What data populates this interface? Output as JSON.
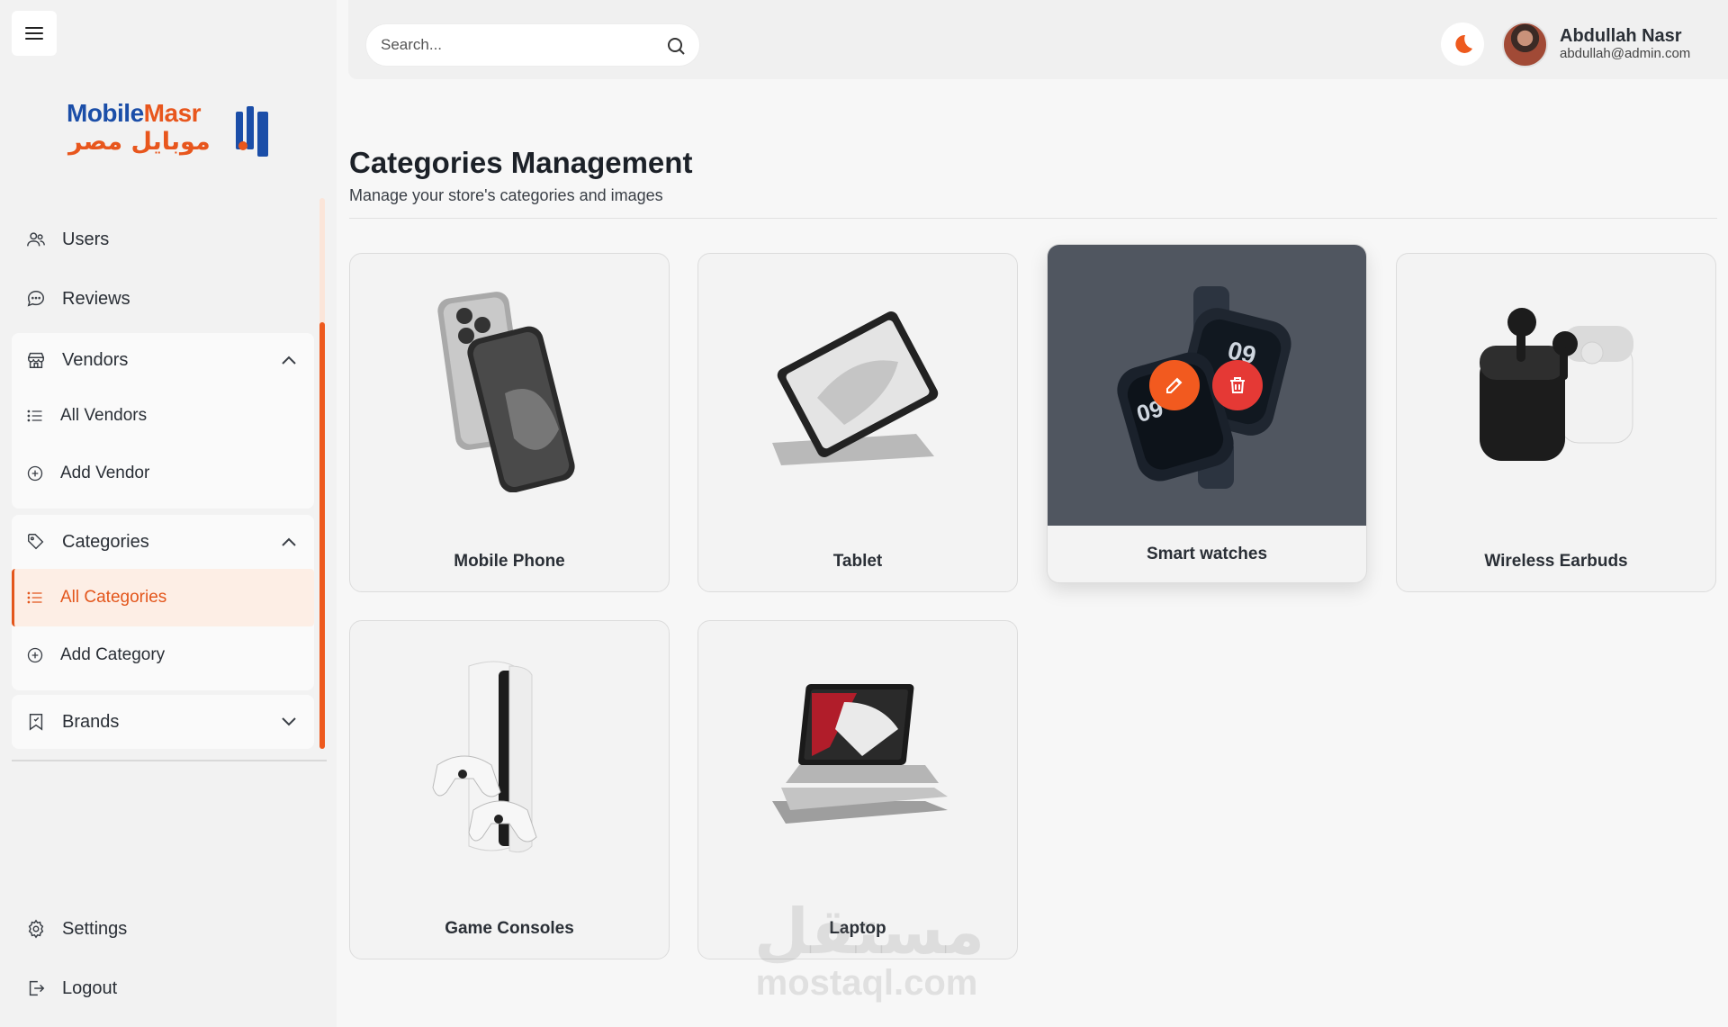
{
  "brand": {
    "name_en_1": "Mobile",
    "name_en_2": "Masr",
    "name_ar": "موبايل مصر"
  },
  "sidebar": {
    "users": "Users",
    "reviews": "Reviews",
    "vendors": {
      "label": "Vendors",
      "items": [
        "All Vendors",
        "Add Vendor"
      ]
    },
    "categories": {
      "label": "Categories",
      "items": [
        "All Categories",
        "Add Category"
      ]
    },
    "brands": "Brands",
    "settings": "Settings",
    "logout": "Logout"
  },
  "header": {
    "search_placeholder": "Search...",
    "user_name": "Abdullah Nasr",
    "user_email": "abdullah@admin.com"
  },
  "page": {
    "title": "Categories Management",
    "subtitle": "Manage your store's categories and images"
  },
  "categories": [
    {
      "name": "Mobile Phone",
      "icon": "phone-image"
    },
    {
      "name": "Tablet",
      "icon": "tablet-image"
    },
    {
      "name": "Smart watches",
      "icon": "smartwatch-image"
    },
    {
      "name": "Wireless Earbuds",
      "icon": "earbuds-image"
    },
    {
      "name": "Game Consoles",
      "icon": "console-image"
    },
    {
      "name": "Laptop",
      "icon": "laptop-image"
    }
  ],
  "watermark": {
    "ar": "مستقل",
    "en": "mostaql.com"
  },
  "colors": {
    "accent": "#ee5a1e",
    "delete": "#e53935",
    "brand_blue": "#1b4ea8"
  }
}
